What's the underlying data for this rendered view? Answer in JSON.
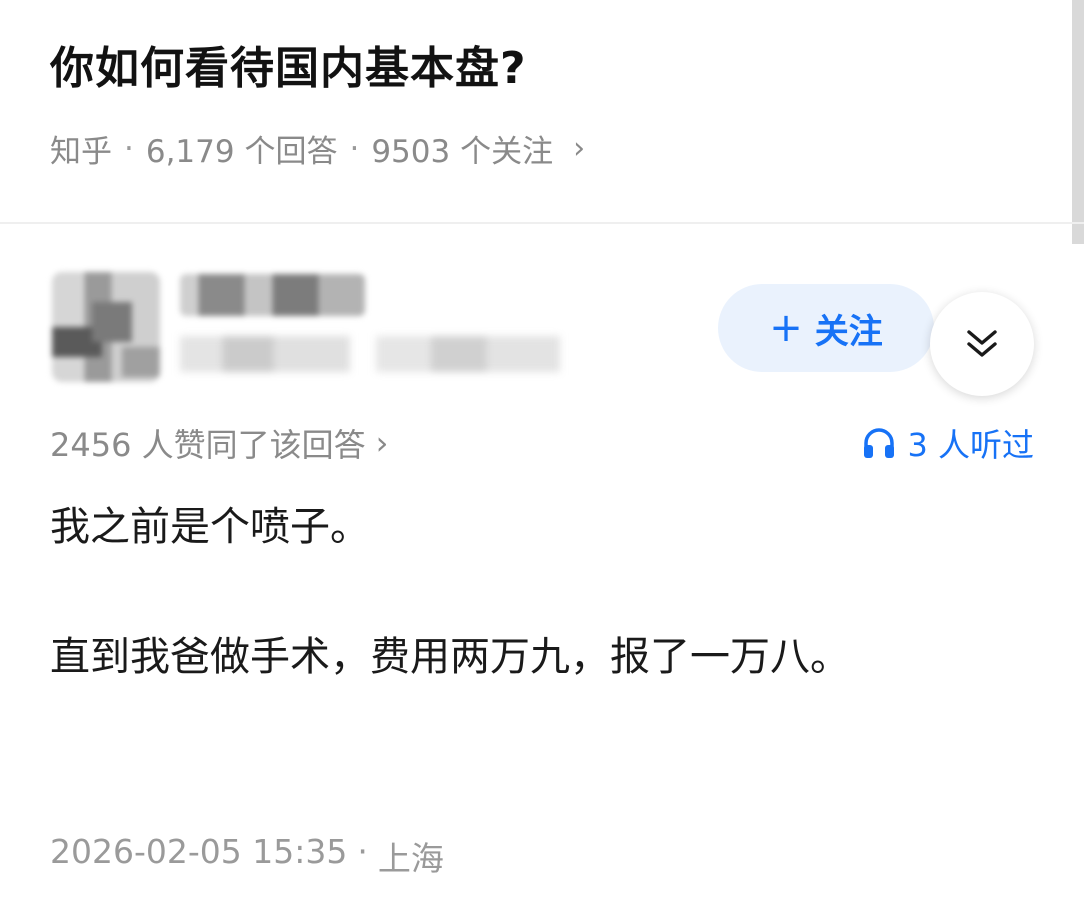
{
  "question": {
    "title": "你如何看待国内基本盘?",
    "source": "知乎",
    "answers_count": "6,179 个回答",
    "followers_count": "9503 个关注"
  },
  "author": {
    "follow_label": "关注"
  },
  "answer": {
    "vote_text": "2456 人赞同了该回答",
    "listen_text": "3 人听过",
    "paragraphs": [
      "我之前是个喷子。",
      "直到我爸做手术，费用两万九，报了一万八。"
    ],
    "timestamp": "2026-02-05 15:35",
    "location": "上海"
  },
  "colors": {
    "accent": "#1772f6",
    "follow_bg": "#eaf2fd",
    "meta_gray": "#8a8a8a"
  },
  "icons": [
    "chevron-right-icon",
    "plus-icon",
    "double-chevron-down-icon",
    "headphones-icon"
  ]
}
